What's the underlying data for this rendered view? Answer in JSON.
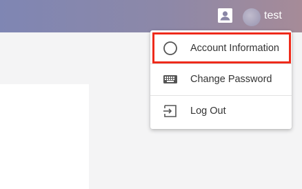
{
  "header": {
    "username": "test",
    "profile_icon": "account-box-icon",
    "avatar": "avatar"
  },
  "menu": {
    "items": [
      {
        "label": "Account Information",
        "icon": "circle-outline-icon"
      },
      {
        "label": "Change Password",
        "icon": "keyboard-icon"
      },
      {
        "label": "Log Out",
        "icon": "logout-icon"
      }
    ]
  },
  "colors": {
    "header_gradient_start": "#7f86b3",
    "header_gradient_end": "#a68b98",
    "highlight": "#ee2a1b",
    "background": "#f4f4f5"
  }
}
